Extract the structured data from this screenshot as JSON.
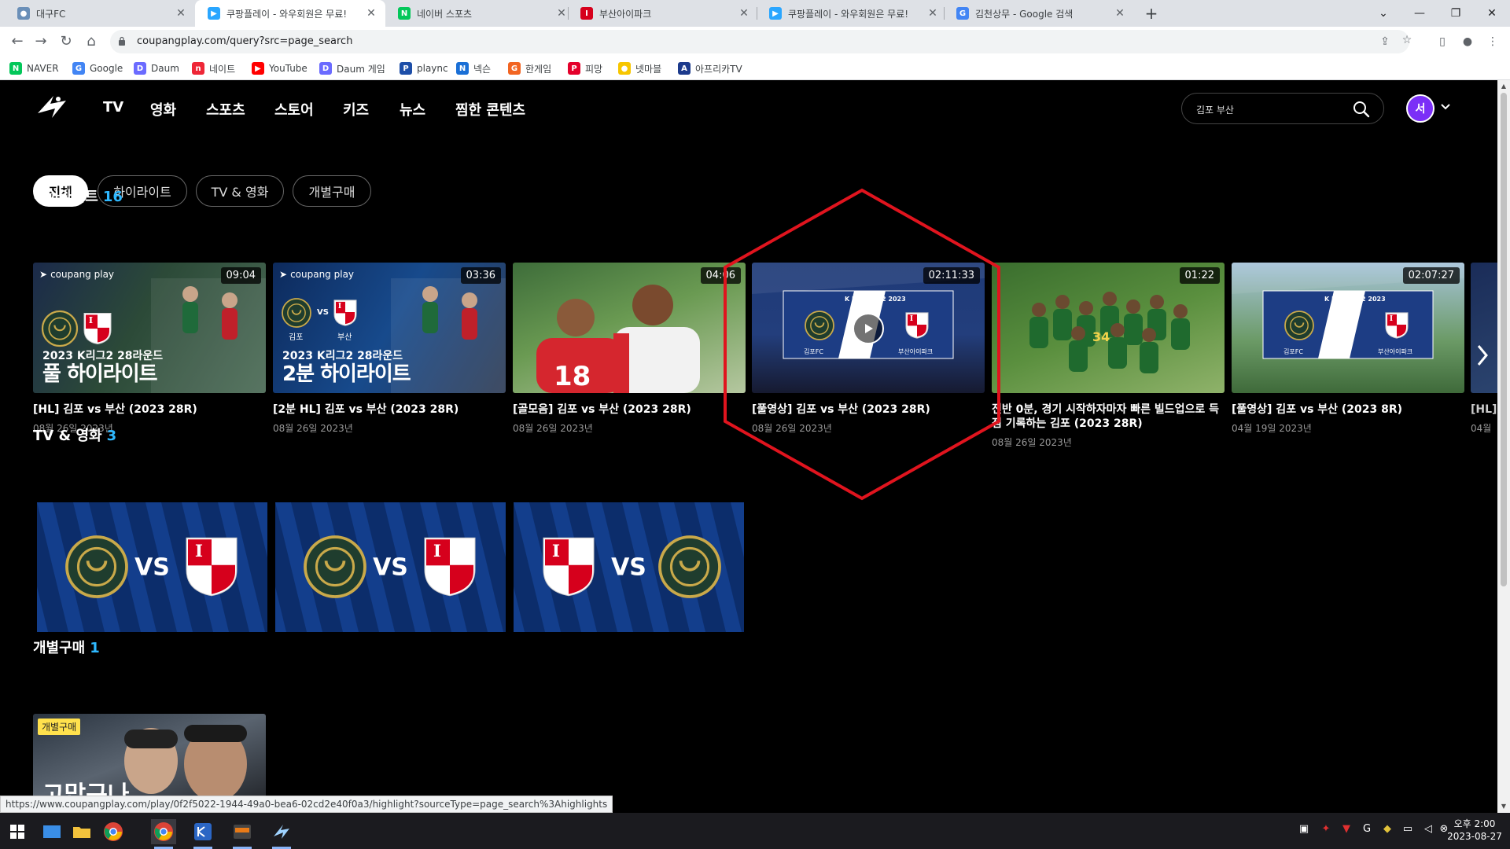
{
  "browser": {
    "tabs": [
      {
        "title": "대구FC",
        "active": false,
        "fav": "#6a8fb8",
        "glyph": "●"
      },
      {
        "title": "쿠팡플레이 - 와우회원은 무료!",
        "active": true,
        "fav": "#2aa6ff",
        "glyph": "▶"
      },
      {
        "title": "네이버 스포츠",
        "active": false,
        "fav": "#03c75a",
        "glyph": "N"
      },
      {
        "title": "부산아이파크",
        "active": false,
        "fav": "#d6001c",
        "glyph": "I"
      },
      {
        "title": "쿠팡플레이 - 와우회원은 무료!",
        "active": false,
        "fav": "#2aa6ff",
        "glyph": "▶"
      },
      {
        "title": "김천상무 - Google 검색",
        "active": false,
        "fav": "#4285f4",
        "glyph": "G"
      }
    ],
    "url": "coupangplay.com/query?src=page_search",
    "bookmarks": [
      {
        "label": "NAVER",
        "color": "#03c75a",
        "glyph": "N"
      },
      {
        "label": "Google",
        "color": "#4285f4",
        "glyph": "G"
      },
      {
        "label": "Daum",
        "color": "#6b6bff",
        "glyph": "D"
      },
      {
        "label": "네이트",
        "color": "#ee2737",
        "glyph": "n"
      },
      {
        "label": "YouTube",
        "color": "#ff0000",
        "glyph": "▶"
      },
      {
        "label": "Daum 게임",
        "color": "#6b6bff",
        "glyph": "D"
      },
      {
        "label": "plaync",
        "color": "#1d4ea8",
        "glyph": "P"
      },
      {
        "label": "넥슨",
        "color": "#1a6fd6",
        "glyph": "N"
      },
      {
        "label": "한게임",
        "color": "#f26522",
        "glyph": "G"
      },
      {
        "label": "피망",
        "color": "#e4002b",
        "glyph": "P"
      },
      {
        "label": "넷마블",
        "color": "#f7c600",
        "glyph": "●"
      },
      {
        "label": "아프리카TV",
        "color": "#1c3a8c",
        "glyph": "A"
      }
    ],
    "status_url": "https://www.coupangplay.com/play/0f2f5022-1944-49a0-bea6-02cd2e40f0a3/highlight?sourceType=page_search%3Ahighlights"
  },
  "header": {
    "nav": [
      "TV",
      "영화",
      "스포츠",
      "스토어",
      "키즈",
      "뉴스",
      "찜한 콘텐츠"
    ],
    "search_value": "김포 부산",
    "avatar_initial": "서"
  },
  "filters": [
    "전체",
    "하이라이트",
    "TV & 영화",
    "개별구매"
  ],
  "highlights": {
    "title": "하이라이트",
    "count": "16",
    "items": [
      {
        "duration": "09:04",
        "title": "[HL] 김포 vs 부산 (2023 28R)",
        "date": "08월 26일 2023년",
        "brand": "coupang play",
        "line1": "2023 K리그2 28라운드",
        "line2": "풀 하이라이트"
      },
      {
        "duration": "03:36",
        "title": "[2분 HL] 김포 vs 부산 (2023 28R)",
        "date": "08월 26일 2023년",
        "brand": "coupang play",
        "line1": "2023 K리그2 28라운드",
        "line2": "2분 하이라이트",
        "tag_home": "김포",
        "tag_vs": "VS",
        "tag_away": "부산"
      },
      {
        "duration": "04:06",
        "title": "[골모음] 김포 vs 부산 (2023 28R)",
        "date": "08월 26일 2023년"
      },
      {
        "duration": "02:11:33",
        "title": "[풀영상] 김포 vs 부산 (2023 28R)",
        "date": "08월 26일 2023년",
        "board": "K LEAGUE 2 2023",
        "home": "김포FC",
        "away": "부산아이파크"
      },
      {
        "duration": "01:22",
        "title": "전반 0분, 경기 시작하자마자 빠른 빌드업으로 득점 기록하는 김포 (2023 28R)",
        "date": "08월 26일 2023년"
      },
      {
        "duration": "02:07:27",
        "title": "[풀영상] 김포 vs 부산 (2023 8R)",
        "date": "04월 19일 2023년",
        "board": "K LEAGUE 2 2023",
        "home": "김포FC",
        "away": "부산아이파크"
      }
    ],
    "partial": {
      "title": "[HL]",
      "date": "04월"
    }
  },
  "tvmovies": {
    "title": "TV & 영화",
    "count": "3",
    "vs_label": "VS"
  },
  "purchase": {
    "title": "개별구매",
    "count": "1",
    "badge": "개별구매",
    "poster_text": "고맙구나"
  },
  "taskbar": {
    "clock_time": "오후 2:00",
    "clock_date": "2023-08-27"
  },
  "colors": {
    "accent": "#2eb8ff",
    "annotation": "#e0141e",
    "team_blue": "#0c2d6b",
    "busan_red": "#d6001c"
  }
}
